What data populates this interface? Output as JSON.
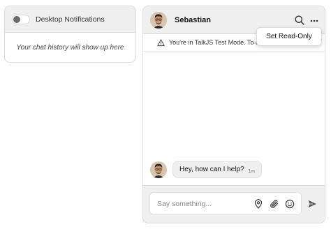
{
  "inbox": {
    "notifications_label": "Desktop Notifications",
    "empty_text": "Your chat history will show up here"
  },
  "chat": {
    "name": "Sebastian",
    "banner": "You're in TalkJS Test Mode. To chat w",
    "menu_item": "Set Read-Only",
    "messages": [
      {
        "text": "Hey, how can I help?",
        "time": "1m"
      }
    ],
    "compose_placeholder": "Say something..."
  },
  "icons": [
    "toggle",
    "search-icon",
    "more-icon",
    "warning-icon",
    "location-icon",
    "paperclip-icon",
    "emoji-icon",
    "send-icon"
  ],
  "colors": {
    "header_bg": "#f0f0f0",
    "border": "#dcdcdc",
    "bubble_bg": "#f0f0f0"
  }
}
